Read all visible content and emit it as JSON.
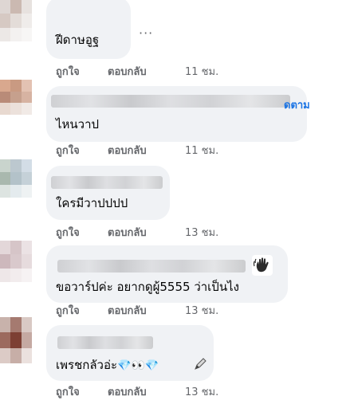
{
  "comments": [
    {
      "text": "ฝีดาษอูฐ",
      "like": "ถูกใจ",
      "reply": "ตอบกลับ",
      "time": "11 ชม."
    },
    {
      "text": "ไหนวาป",
      "like": "ถูกใจ",
      "reply": "ตอบกลับ",
      "time": "11 ชม.",
      "follow": "ดตาม"
    },
    {
      "text": "ใครมีวาปปปป",
      "like": "ถูกใจ",
      "reply": "ตอบกลับ",
      "time": "13 ชม."
    },
    {
      "text": "ขอวาร์ปค่ะ อยากดูผู้5555 ว่าเป็นไง",
      "like": "ถูกใจ",
      "reply": "ตอบกลับ",
      "time": "13 ชม."
    },
    {
      "text": "เพรชกลัวอ่ะ",
      "emoji": "💎👀💎",
      "like": "ถูกใจ",
      "reply": "ตอบกลับ",
      "time": "13 ชม."
    }
  ],
  "more_label": "···",
  "icons": {
    "more": "ellipsis-icon",
    "wave": "waving-hand-icon",
    "edit": "pen-icon"
  }
}
